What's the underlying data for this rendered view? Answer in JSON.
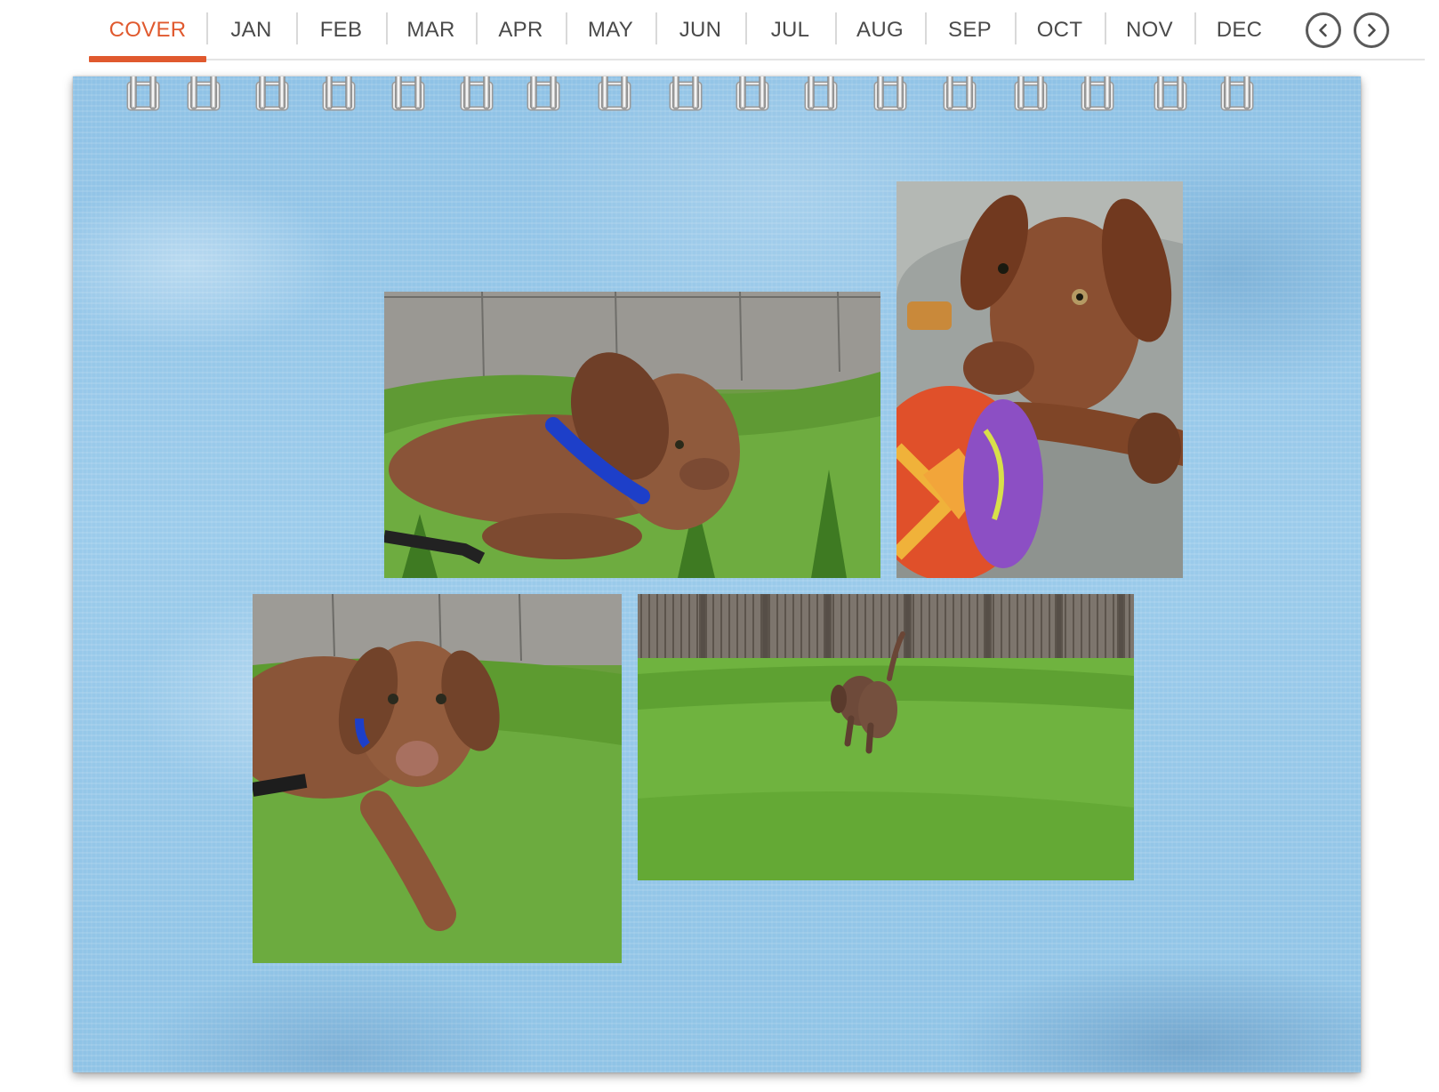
{
  "tabs": [
    {
      "label": "COVER",
      "active": true
    },
    {
      "label": "JAN",
      "active": false
    },
    {
      "label": "FEB",
      "active": false
    },
    {
      "label": "MAR",
      "active": false
    },
    {
      "label": "APR",
      "active": false
    },
    {
      "label": "MAY",
      "active": false
    },
    {
      "label": "JUN",
      "active": false
    },
    {
      "label": "JUL",
      "active": false
    },
    {
      "label": "AUG",
      "active": false
    },
    {
      "label": "SEP",
      "active": false
    },
    {
      "label": "OCT",
      "active": false
    },
    {
      "label": "NOV",
      "active": false
    },
    {
      "label": "DEC",
      "active": false
    }
  ],
  "nav": {
    "prev_icon": "chevron-left-circle-icon",
    "next_icon": "chevron-right-circle-icon"
  },
  "colors": {
    "accent": "#e0592e",
    "tab_text": "#4a4a4a",
    "page_blue": "#95c7e8"
  },
  "photos": [
    {
      "subject": "puppy-lying-in-grass-side-view"
    },
    {
      "subject": "puppy-resting-on-blanket-with-toy-ball"
    },
    {
      "subject": "puppy-lying-in-grass-facing-camera"
    },
    {
      "subject": "puppy-walking-on-lawn-by-fence"
    }
  ]
}
